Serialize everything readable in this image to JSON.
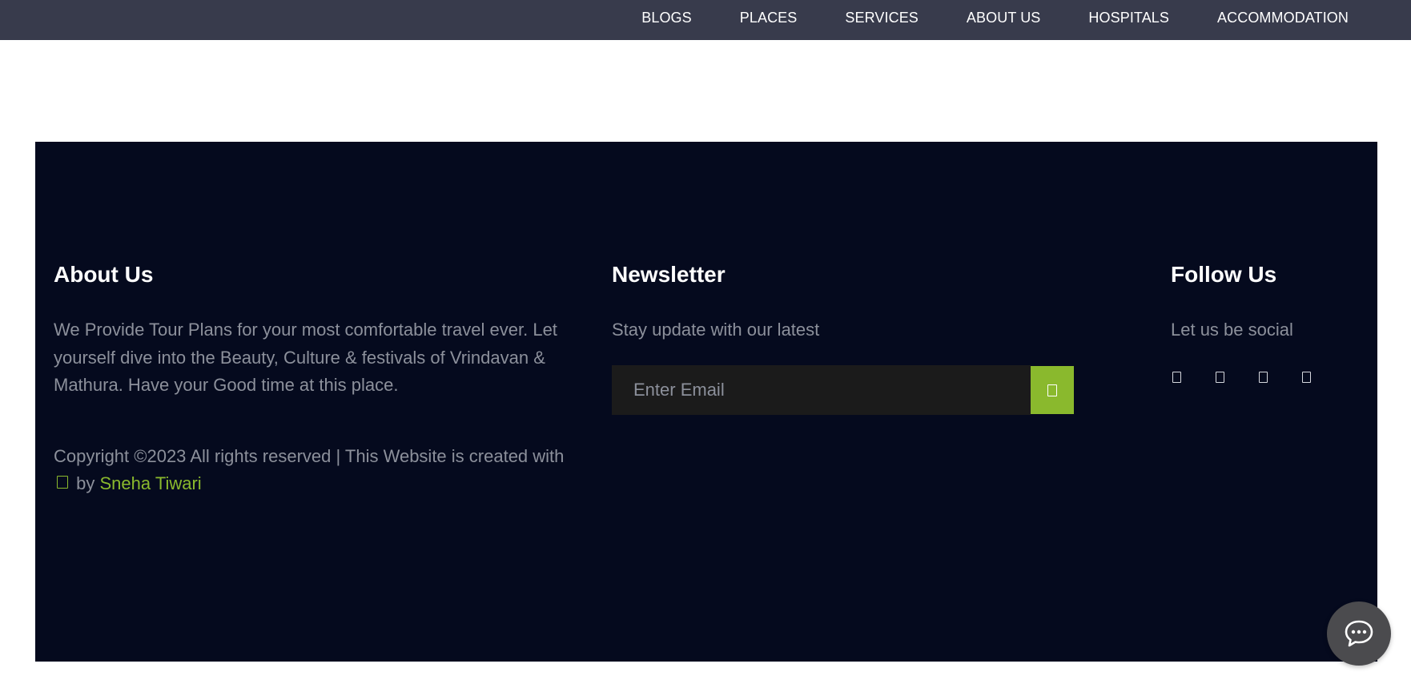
{
  "nav": {
    "items": [
      {
        "label": "BLOGS"
      },
      {
        "label": "PLACES"
      },
      {
        "label": "SERVICES"
      },
      {
        "label": "ABOUT US"
      },
      {
        "label": "HOSPITALS"
      },
      {
        "label": "ACCOMMODATION"
      }
    ]
  },
  "footer": {
    "about": {
      "heading": "About Us",
      "text": "We Provide Tour Plans for your most comfortable travel ever. Let yourself dive into the Beauty, Culture & festivals of Vrindavan & Mathura. Have your Good time at this place.",
      "copyright_prefix": "Copyright ©2023 All rights reserved | This Website is created with",
      "copyright_by": "by",
      "author": "Sneha Tiwari"
    },
    "newsletter": {
      "heading": "Newsletter",
      "text": "Stay update with our latest",
      "email_placeholder": "Enter Email",
      "submit_icon": "paper-plane-icon"
    },
    "follow": {
      "heading": "Follow Us",
      "text": "Let us be social",
      "icons": [
        "facebook-icon",
        "twitter-icon",
        "instagram-icon",
        "linkedin-icon"
      ]
    }
  },
  "chat": {
    "icon": "chat-bubble-icon"
  },
  "colors": {
    "navbar_bg": "#383b4c",
    "footer_bg": "#050a1e",
    "accent": "#8ab92d",
    "muted_text": "#8c909b",
    "input_bg": "#1b1b1b"
  }
}
